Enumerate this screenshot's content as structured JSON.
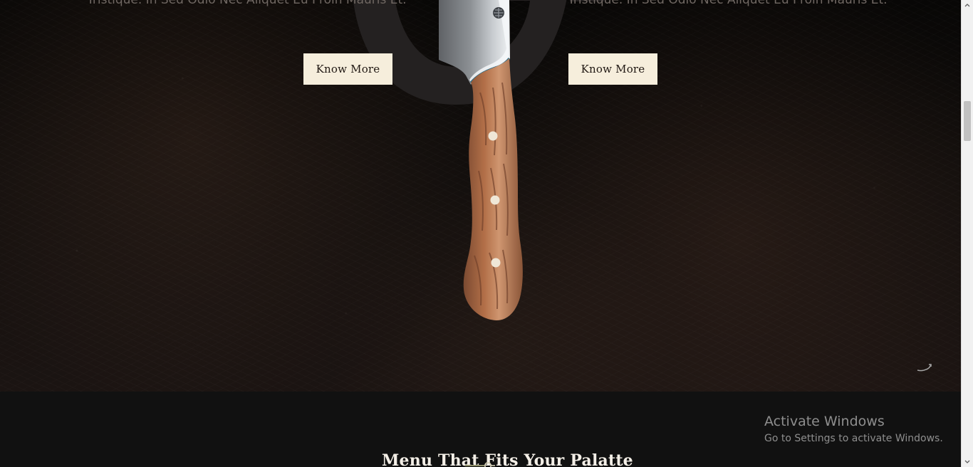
{
  "hero": {
    "left_text": "Tristique. In Sed Odio Nec Aliquet Eu Proin Mauris Et.",
    "right_text": "Tristique. In Sed Odio Nec Aliquet Eu Proin Mauris Et.",
    "left_button_label": "Know More",
    "right_button_label": "Know More"
  },
  "section": {
    "title": "Menu That Fits Your Palatte"
  },
  "watermark": {
    "title": "Activate Windows",
    "subtitle": "Go to Settings to activate Windows."
  },
  "icons": {
    "decorative_letter": "decorative-letter-icon",
    "knife": "knife-icon",
    "scroll_hook": "scroll-hook-icon",
    "divider": "section-divider-icon",
    "scroll_up": "scroll-up-arrow-icon",
    "scroll_down": "scroll-down-arrow-icon"
  },
  "colors": {
    "background_dark": "#111111",
    "button_background": "#f6eedc",
    "button_text": "#1f1712",
    "heading_text": "#f4efe7",
    "muted_text": "#6f6762",
    "watermark_text": "#8e8e8e",
    "scrollbar_track": "#f1f1f1",
    "scrollbar_thumb": "#c1c1c1"
  }
}
